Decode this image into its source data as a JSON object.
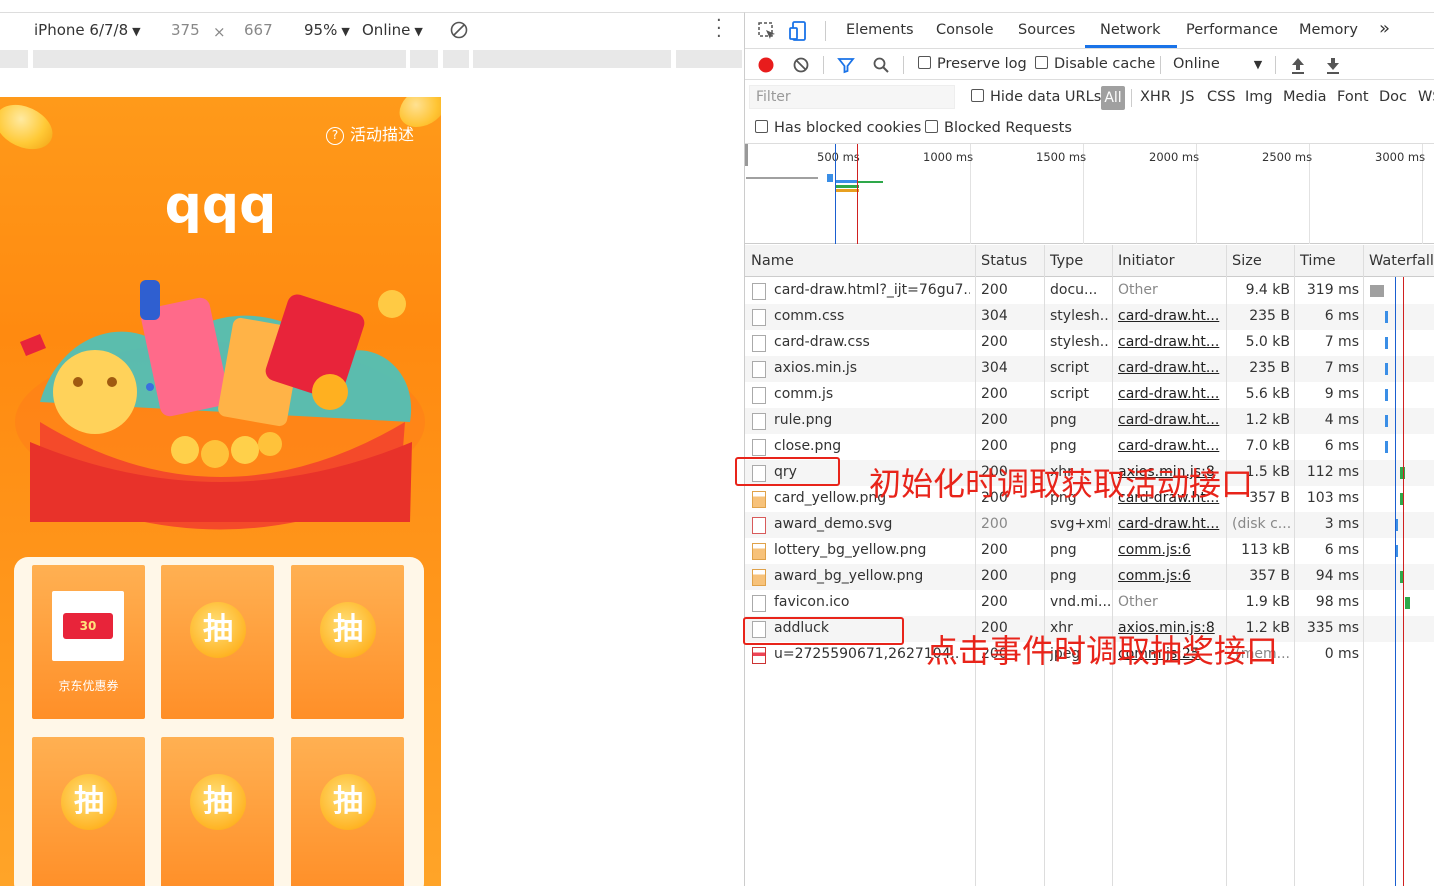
{
  "device_toolbar": {
    "device": "iPhone 6/7/8",
    "width": "375",
    "times": "×",
    "height": "667",
    "zoom": "95%",
    "throttle": "Online"
  },
  "mobile_page": {
    "description_link": "活动描述",
    "title": "qqq",
    "cards": [
      {
        "type": "prize",
        "coupon": "30",
        "label": "京东优惠券"
      },
      {
        "type": "draw",
        "label": "抽"
      },
      {
        "type": "draw",
        "label": "抽"
      },
      {
        "type": "draw",
        "label": "抽"
      },
      {
        "type": "draw",
        "label": "抽"
      },
      {
        "type": "draw",
        "label": "抽"
      }
    ]
  },
  "devtools": {
    "tabs": [
      "Elements",
      "Console",
      "Sources",
      "Network",
      "Performance",
      "Memory"
    ],
    "more_tabs": "»",
    "active_tab": "Network",
    "toolbar": {
      "preserve_log": "Preserve log",
      "disable_cache": "Disable cache",
      "throttle": "Online"
    },
    "filter": {
      "placeholder": "Filter",
      "hide_data_urls": "Hide data URLs",
      "types": [
        "All",
        "XHR",
        "JS",
        "CSS",
        "Img",
        "Media",
        "Font",
        "Doc",
        "WS"
      ],
      "has_blocked_cookies": "Has blocked cookies",
      "blocked_requests": "Blocked Requests"
    },
    "overview_ticks": [
      "500 ms",
      "1000 ms",
      "1500 ms",
      "2000 ms",
      "2500 ms",
      "3000 ms"
    ],
    "columns": [
      "Name",
      "Status",
      "Type",
      "Initiator",
      "Size",
      "Time",
      "Waterfall"
    ],
    "requests": [
      {
        "name": "card-draw.html?_ijt=76gu7...",
        "status": "200",
        "type": "docu...",
        "initiator": "Other",
        "initiator_link": false,
        "size": "9.4 kB",
        "time": "319 ms",
        "icon": "doc",
        "wf_color": "#a0a0a0",
        "wf_start": 0.0,
        "wf_end": 0.23
      },
      {
        "name": "comm.css",
        "status": "304",
        "type": "stylesh...",
        "initiator": "card-draw.ht...",
        "initiator_link": true,
        "size": "235 B",
        "time": "6 ms",
        "icon": "doc",
        "wf_color": "#3a8ee6",
        "wf_start": 0.25,
        "wf_end": 0.27
      },
      {
        "name": "card-draw.css",
        "status": "200",
        "type": "stylesh...",
        "initiator": "card-draw.ht...",
        "initiator_link": true,
        "size": "5.0 kB",
        "time": "7 ms",
        "icon": "doc",
        "wf_color": "#3a8ee6",
        "wf_start": 0.25,
        "wf_end": 0.27
      },
      {
        "name": "axios.min.js",
        "status": "304",
        "type": "script",
        "initiator": "card-draw.ht...",
        "initiator_link": true,
        "size": "235 B",
        "time": "7 ms",
        "icon": "doc",
        "wf_color": "#3a8ee6",
        "wf_start": 0.25,
        "wf_end": 0.27
      },
      {
        "name": "comm.js",
        "status": "200",
        "type": "script",
        "initiator": "card-draw.ht...",
        "initiator_link": true,
        "size": "5.6 kB",
        "time": "9 ms",
        "icon": "doc",
        "wf_color": "#3a8ee6",
        "wf_start": 0.25,
        "wf_end": 0.27
      },
      {
        "name": "rule.png",
        "status": "200",
        "type": "png",
        "initiator": "card-draw.ht...",
        "initiator_link": true,
        "size": "1.2 kB",
        "time": "4 ms",
        "icon": "blank",
        "wf_color": "#3a8ee6",
        "wf_start": 0.25,
        "wf_end": 0.27
      },
      {
        "name": "close.png",
        "status": "200",
        "type": "png",
        "initiator": "card-draw.ht...",
        "initiator_link": true,
        "size": "7.0 kB",
        "time": "6 ms",
        "icon": "blank",
        "wf_color": "#3a8ee6",
        "wf_start": 0.25,
        "wf_end": 0.27
      },
      {
        "name": "qry",
        "status": "200",
        "type": "xhr",
        "initiator": "axios.min.js:8",
        "initiator_link": true,
        "size": "1.5 kB",
        "time": "112 ms",
        "icon": "blank",
        "wf_color": "#2ea84a",
        "wf_start": 0.5,
        "wf_end": 0.58
      },
      {
        "name": "card_yellow.png",
        "status": "200",
        "type": "png",
        "initiator": "card-draw.ht...",
        "initiator_link": true,
        "size": "357 B",
        "time": "103 ms",
        "icon": "img",
        "wf_color": "#2ea84a",
        "wf_start": 0.5,
        "wf_end": 0.57
      },
      {
        "name": "award_demo.svg",
        "status": "200",
        "type": "svg+xml",
        "initiator": "card-draw.ht...",
        "initiator_link": true,
        "size": "(disk c...",
        "time": "3 ms",
        "icon": "svg",
        "wf_color": "#3a8ee6",
        "wf_start": 0.42,
        "wf_end": 0.44
      },
      {
        "name": "lottery_bg_yellow.png",
        "status": "200",
        "type": "png",
        "initiator": "comm.js:6",
        "initiator_link": true,
        "size": "113 kB",
        "time": "6 ms",
        "icon": "img",
        "wf_color": "#3a8ee6",
        "wf_start": 0.42,
        "wf_end": 0.44
      },
      {
        "name": "award_bg_yellow.png",
        "status": "200",
        "type": "png",
        "initiator": "comm.js:6",
        "initiator_link": true,
        "size": "357 B",
        "time": "94 ms",
        "icon": "img",
        "wf_color": "#2ea84a",
        "wf_start": 0.5,
        "wf_end": 0.56
      },
      {
        "name": "favicon.ico",
        "status": "200",
        "type": "vnd.mi...",
        "initiator": "Other",
        "initiator_link": false,
        "size": "1.9 kB",
        "time": "98 ms",
        "icon": "blank",
        "wf_color": "#2ea84a",
        "wf_start": 0.58,
        "wf_end": 0.66
      },
      {
        "name": "addluck",
        "status": "200",
        "type": "xhr",
        "initiator": "axios.min.js:8",
        "initiator_link": true,
        "size": "1.2 kB",
        "time": "335 ms",
        "icon": "blank",
        "wf_color": "#ffffff",
        "wf_start": 0.0,
        "wf_end": 0.0
      },
      {
        "name": "u=2725590671,2627104..",
        "status": "200",
        "type": "jpeg",
        "initiator": "comm.js:25",
        "initiator_link": true,
        "size": "(mem...",
        "time": "0 ms",
        "icon": "jpeg",
        "wf_color": "#ffffff",
        "wf_start": 0.0,
        "wf_end": 0.0
      }
    ]
  },
  "annotations": {
    "qry_note": "初始化时调取获取活动接口",
    "addluck_note": "点击事件时调取抽奖接口",
    "color": "#e8241a"
  }
}
